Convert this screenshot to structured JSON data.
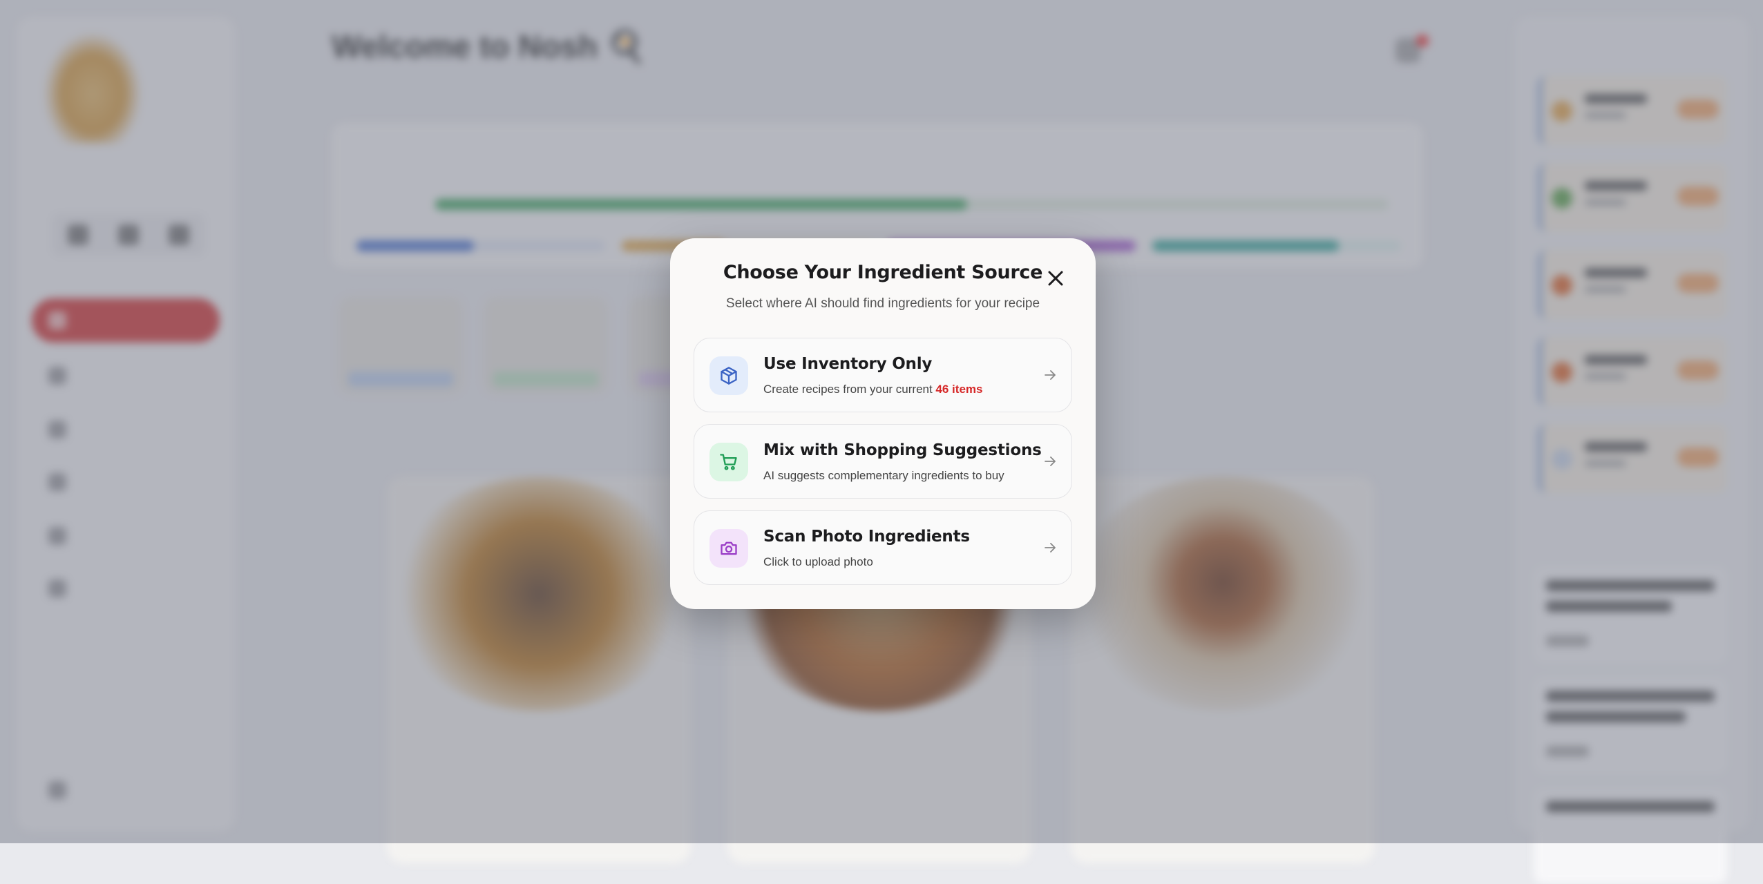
{
  "modal": {
    "title": "Choose Your Ingredient Source",
    "subtitle": "Select where AI should find ingredients for your recipe",
    "options": [
      {
        "title": "Use Inventory Only",
        "desc_prefix": "Create recipes from your current ",
        "desc_highlight": "46 items",
        "icon": "package-icon",
        "icon_bg": "#e3ecfb",
        "icon_color": "#3b63c4"
      },
      {
        "title": "Mix with Shopping Suggestions",
        "desc": "AI suggests complementary ingredients to buy",
        "icon": "shopping-cart-icon",
        "icon_bg": "#dcf6e4",
        "icon_color": "#1f9d55"
      },
      {
        "title": "Scan Photo Ingredients",
        "desc": "Click to upload photo",
        "icon": "camera-icon",
        "icon_bg": "#f3e3fa",
        "icon_color": "#9b3fc7"
      }
    ],
    "highlight_color": "#d62828"
  },
  "background": {
    "page_title": "Welcome to Nosh 🍳",
    "accent_color": "#d33131"
  }
}
